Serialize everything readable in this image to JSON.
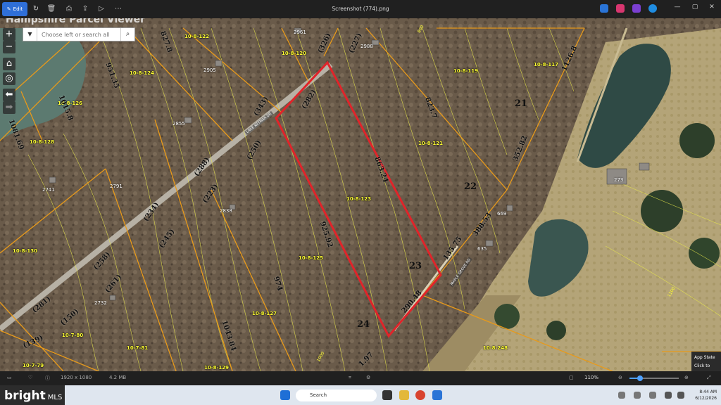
{
  "window": {
    "file_title": "Screenshot (774).png",
    "edit_label": "Edit"
  },
  "viewer": {
    "title": "Hampshire Parcel Viewer",
    "search_placeholder": "Choose left or search all"
  },
  "parcels": [
    {
      "id": "p1",
      "label": "10-8-122",
      "cls": "l1"
    },
    {
      "id": "p2",
      "label": "10-8-120",
      "cls": "l2"
    },
    {
      "id": "p3",
      "label": "10-8-124",
      "cls": "l3"
    },
    {
      "id": "p4",
      "label": "10-8-126",
      "cls": "l4"
    },
    {
      "id": "p5",
      "label": "10-8-128",
      "cls": "l5"
    },
    {
      "id": "p6",
      "label": "10-8-119",
      "cls": "l6"
    },
    {
      "id": "p7",
      "label": "10-8-117",
      "cls": "l7"
    },
    {
      "id": "p8",
      "label": "10-8-121",
      "cls": "l8"
    },
    {
      "id": "p9",
      "label": "10-8-123",
      "cls": "l9"
    },
    {
      "id": "p10",
      "label": "10-8-125",
      "cls": "l10"
    },
    {
      "id": "p11",
      "label": "10-8-127",
      "cls": "l11"
    },
    {
      "id": "p12",
      "label": "10-8-130",
      "cls": "l12"
    },
    {
      "id": "p13",
      "label": "10-7-80",
      "cls": "l13"
    },
    {
      "id": "p14",
      "label": "10-7-81",
      "cls": "l14"
    },
    {
      "id": "p15",
      "label": "10-7-79",
      "cls": "l15"
    },
    {
      "id": "p16",
      "label": "10-8-129",
      "cls": "l16"
    },
    {
      "id": "p17",
      "label": "10-8-248",
      "cls": "l17"
    }
  ],
  "dimensions": [
    {
      "label": "827.8",
      "cls": "d1"
    },
    {
      "label": "951.35",
      "cls": "d2"
    },
    {
      "label": "1015.8",
      "cls": "d3"
    },
    {
      "label": "1081.69",
      "cls": "d4"
    },
    {
      "label": "(326)",
      "cls": "d5"
    },
    {
      "label": "(227)",
      "cls": "d6"
    },
    {
      "label": "(282)",
      "cls": "d7"
    },
    {
      "label": "(343)",
      "cls": "d8"
    },
    {
      "label": "(250)",
      "cls": "d9"
    },
    {
      "label": "(288)",
      "cls": "d10"
    },
    {
      "label": "(223)",
      "cls": "d11"
    },
    {
      "label": "(234)",
      "cls": "d12"
    },
    {
      "label": "(245)",
      "cls": "d13"
    },
    {
      "label": "(258)",
      "cls": "d14"
    },
    {
      "label": "(261)",
      "cls": "d15"
    },
    {
      "label": "(281)",
      "cls": "d16"
    },
    {
      "label": "(150)",
      "cls": "d17"
    },
    {
      "label": "(139)",
      "cls": "d18"
    },
    {
      "label": "823.7",
      "cls": "d19"
    },
    {
      "label": "863.24",
      "cls": "d20"
    },
    {
      "label": "1126.8",
      "cls": "d21"
    },
    {
      "label": "352.82",
      "cls": "d22"
    },
    {
      "label": "925.92",
      "cls": "d23"
    },
    {
      "label": "974",
      "cls": "d24"
    },
    {
      "label": "1043.84",
      "cls": "d25"
    },
    {
      "label": "388.53",
      "cls": "d26"
    },
    {
      "label": "135.75",
      "cls": "d27"
    },
    {
      "label": "290.48",
      "cls": "d28"
    },
    {
      "label": "1.97",
      "cls": "d29"
    }
  ],
  "lots": [
    {
      "label": "21",
      "cls": "t1"
    },
    {
      "label": "22",
      "cls": "t2"
    },
    {
      "label": "23",
      "cls": "t3"
    },
    {
      "label": "24",
      "cls": "t4"
    }
  ],
  "addresses": [
    {
      "label": "2961",
      "cls": "a1"
    },
    {
      "label": "2988",
      "cls": "a2"
    },
    {
      "label": "2905",
      "cls": "a3"
    },
    {
      "label": "2855",
      "cls": "a4"
    },
    {
      "label": "2741",
      "cls": "a5"
    },
    {
      "label": "2791",
      "cls": "a6"
    },
    {
      "label": "2838",
      "cls": "a7"
    },
    {
      "label": "2732",
      "cls": "a8"
    },
    {
      "label": "273",
      "cls": "a9"
    },
    {
      "label": "669",
      "cls": "a10"
    },
    {
      "label": "635",
      "cls": "a11"
    }
  ],
  "roads": [
    {
      "label": "LAKE KEYMAR DR",
      "cls": "r1"
    },
    {
      "label": "MAPLE GROVE RD",
      "cls": "r2"
    }
  ],
  "contours": [
    {
      "label": "800",
      "cls": "c1"
    },
    {
      "label": "1100",
      "cls": "c2"
    },
    {
      "label": "1000",
      "cls": "c3"
    }
  ],
  "app_state": {
    "line1": "App State",
    "line2": "Click to rest"
  },
  "statusbar": {
    "dimensions": "1920 x 1080",
    "size": "4.2 MB",
    "zoom": "110%"
  },
  "taskbar": {
    "search": "Search",
    "time": "8:44 AM",
    "date": "6/12/2026"
  },
  "watermark": {
    "brand": "bright",
    "suffix": "MLS"
  }
}
